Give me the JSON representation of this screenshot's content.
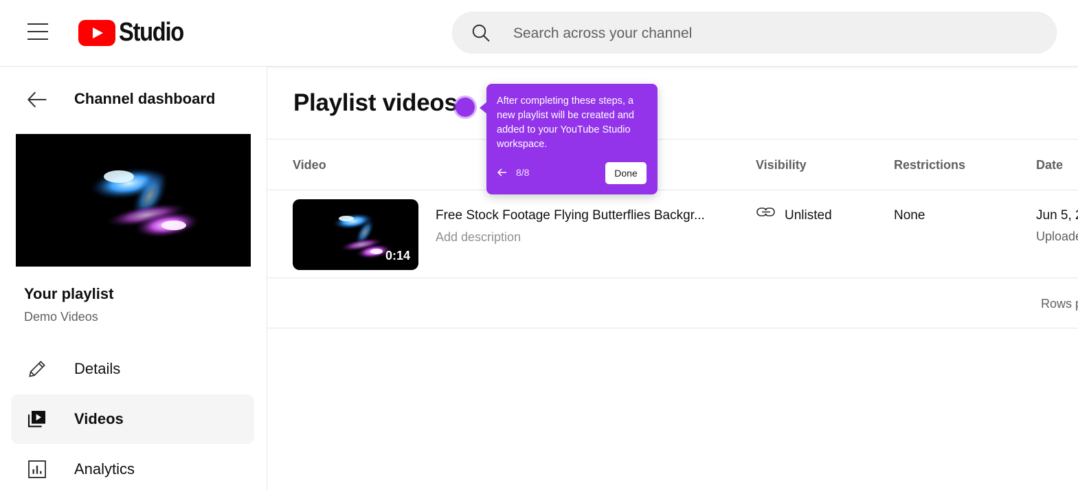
{
  "header": {
    "logo_text": "Studio",
    "search_placeholder": "Search across your channel"
  },
  "sidebar": {
    "back_label": "Channel dashboard",
    "playlist_title": "Your playlist",
    "playlist_name": "Demo Videos",
    "nav": [
      {
        "label": "Details",
        "icon": "pencil-icon",
        "active": false
      },
      {
        "label": "Videos",
        "icon": "video-library-icon",
        "active": true
      },
      {
        "label": "Analytics",
        "icon": "analytics-icon",
        "active": false
      }
    ]
  },
  "main": {
    "title": "Playlist videos",
    "columns": [
      "Video",
      "Visibility",
      "Restrictions",
      "Date"
    ],
    "rows": [
      {
        "title": "Free Stock Footage Flying Butterflies Backgr...",
        "description": "Add description",
        "duration": "0:14",
        "visibility": "Unlisted",
        "restrictions": "None",
        "date": "Jun 5, 2",
        "date_sub": "Uploade"
      }
    ],
    "footer_rows_label": "Rows p"
  },
  "tooltip": {
    "text": "After completing these steps, a new playlist will be created and added to your YouTube Studio workspace.",
    "step": "8/8",
    "done_label": "Done"
  },
  "colors": {
    "accent": "#9333ea",
    "brand_red": "#ff0000"
  }
}
